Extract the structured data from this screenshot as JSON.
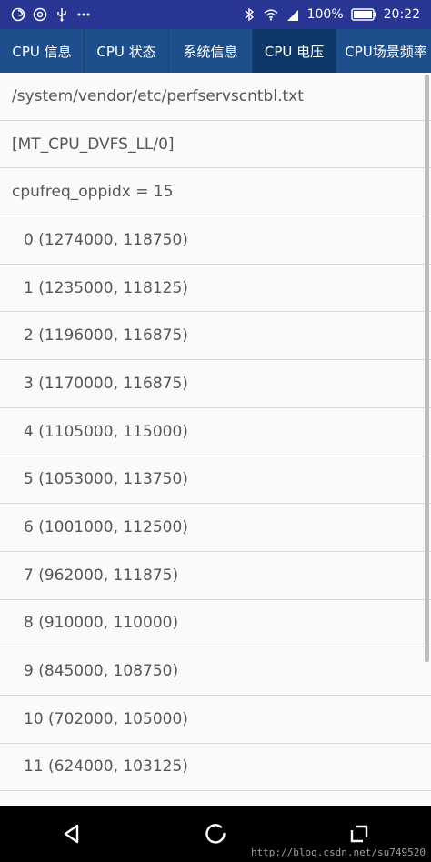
{
  "statusbar": {
    "battery_percent": "100%",
    "time": "20:22",
    "more_icon": "more-dots-icon"
  },
  "tabs": [
    {
      "label": "CPU 信息",
      "active": false
    },
    {
      "label": "CPU 状态",
      "active": false
    },
    {
      "label": "系统信息",
      "active": false
    },
    {
      "label": "CPU 电压",
      "active": true
    },
    {
      "label": "CPU场景频率",
      "active": false
    }
  ],
  "list": [
    "/system/vendor/etc/perfservscntbl.txt",
    "[MT_CPU_DVFS_LL/0]",
    "cpufreq_oppidx = 15",
    "0  (1274000, 118750)",
    "1  (1235000, 118125)",
    "2  (1196000, 116875)",
    "3  (1170000, 116875)",
    "4  (1105000, 115000)",
    "5  (1053000, 113750)",
    "6  (1001000, 112500)",
    "7  (962000, 111875)",
    "8  (910000, 110000)",
    "9  (845000, 108750)",
    "10 (702000, 105000)",
    "11 (624000, 103125)"
  ],
  "watermark": "http://blog.csdn.net/su749520"
}
